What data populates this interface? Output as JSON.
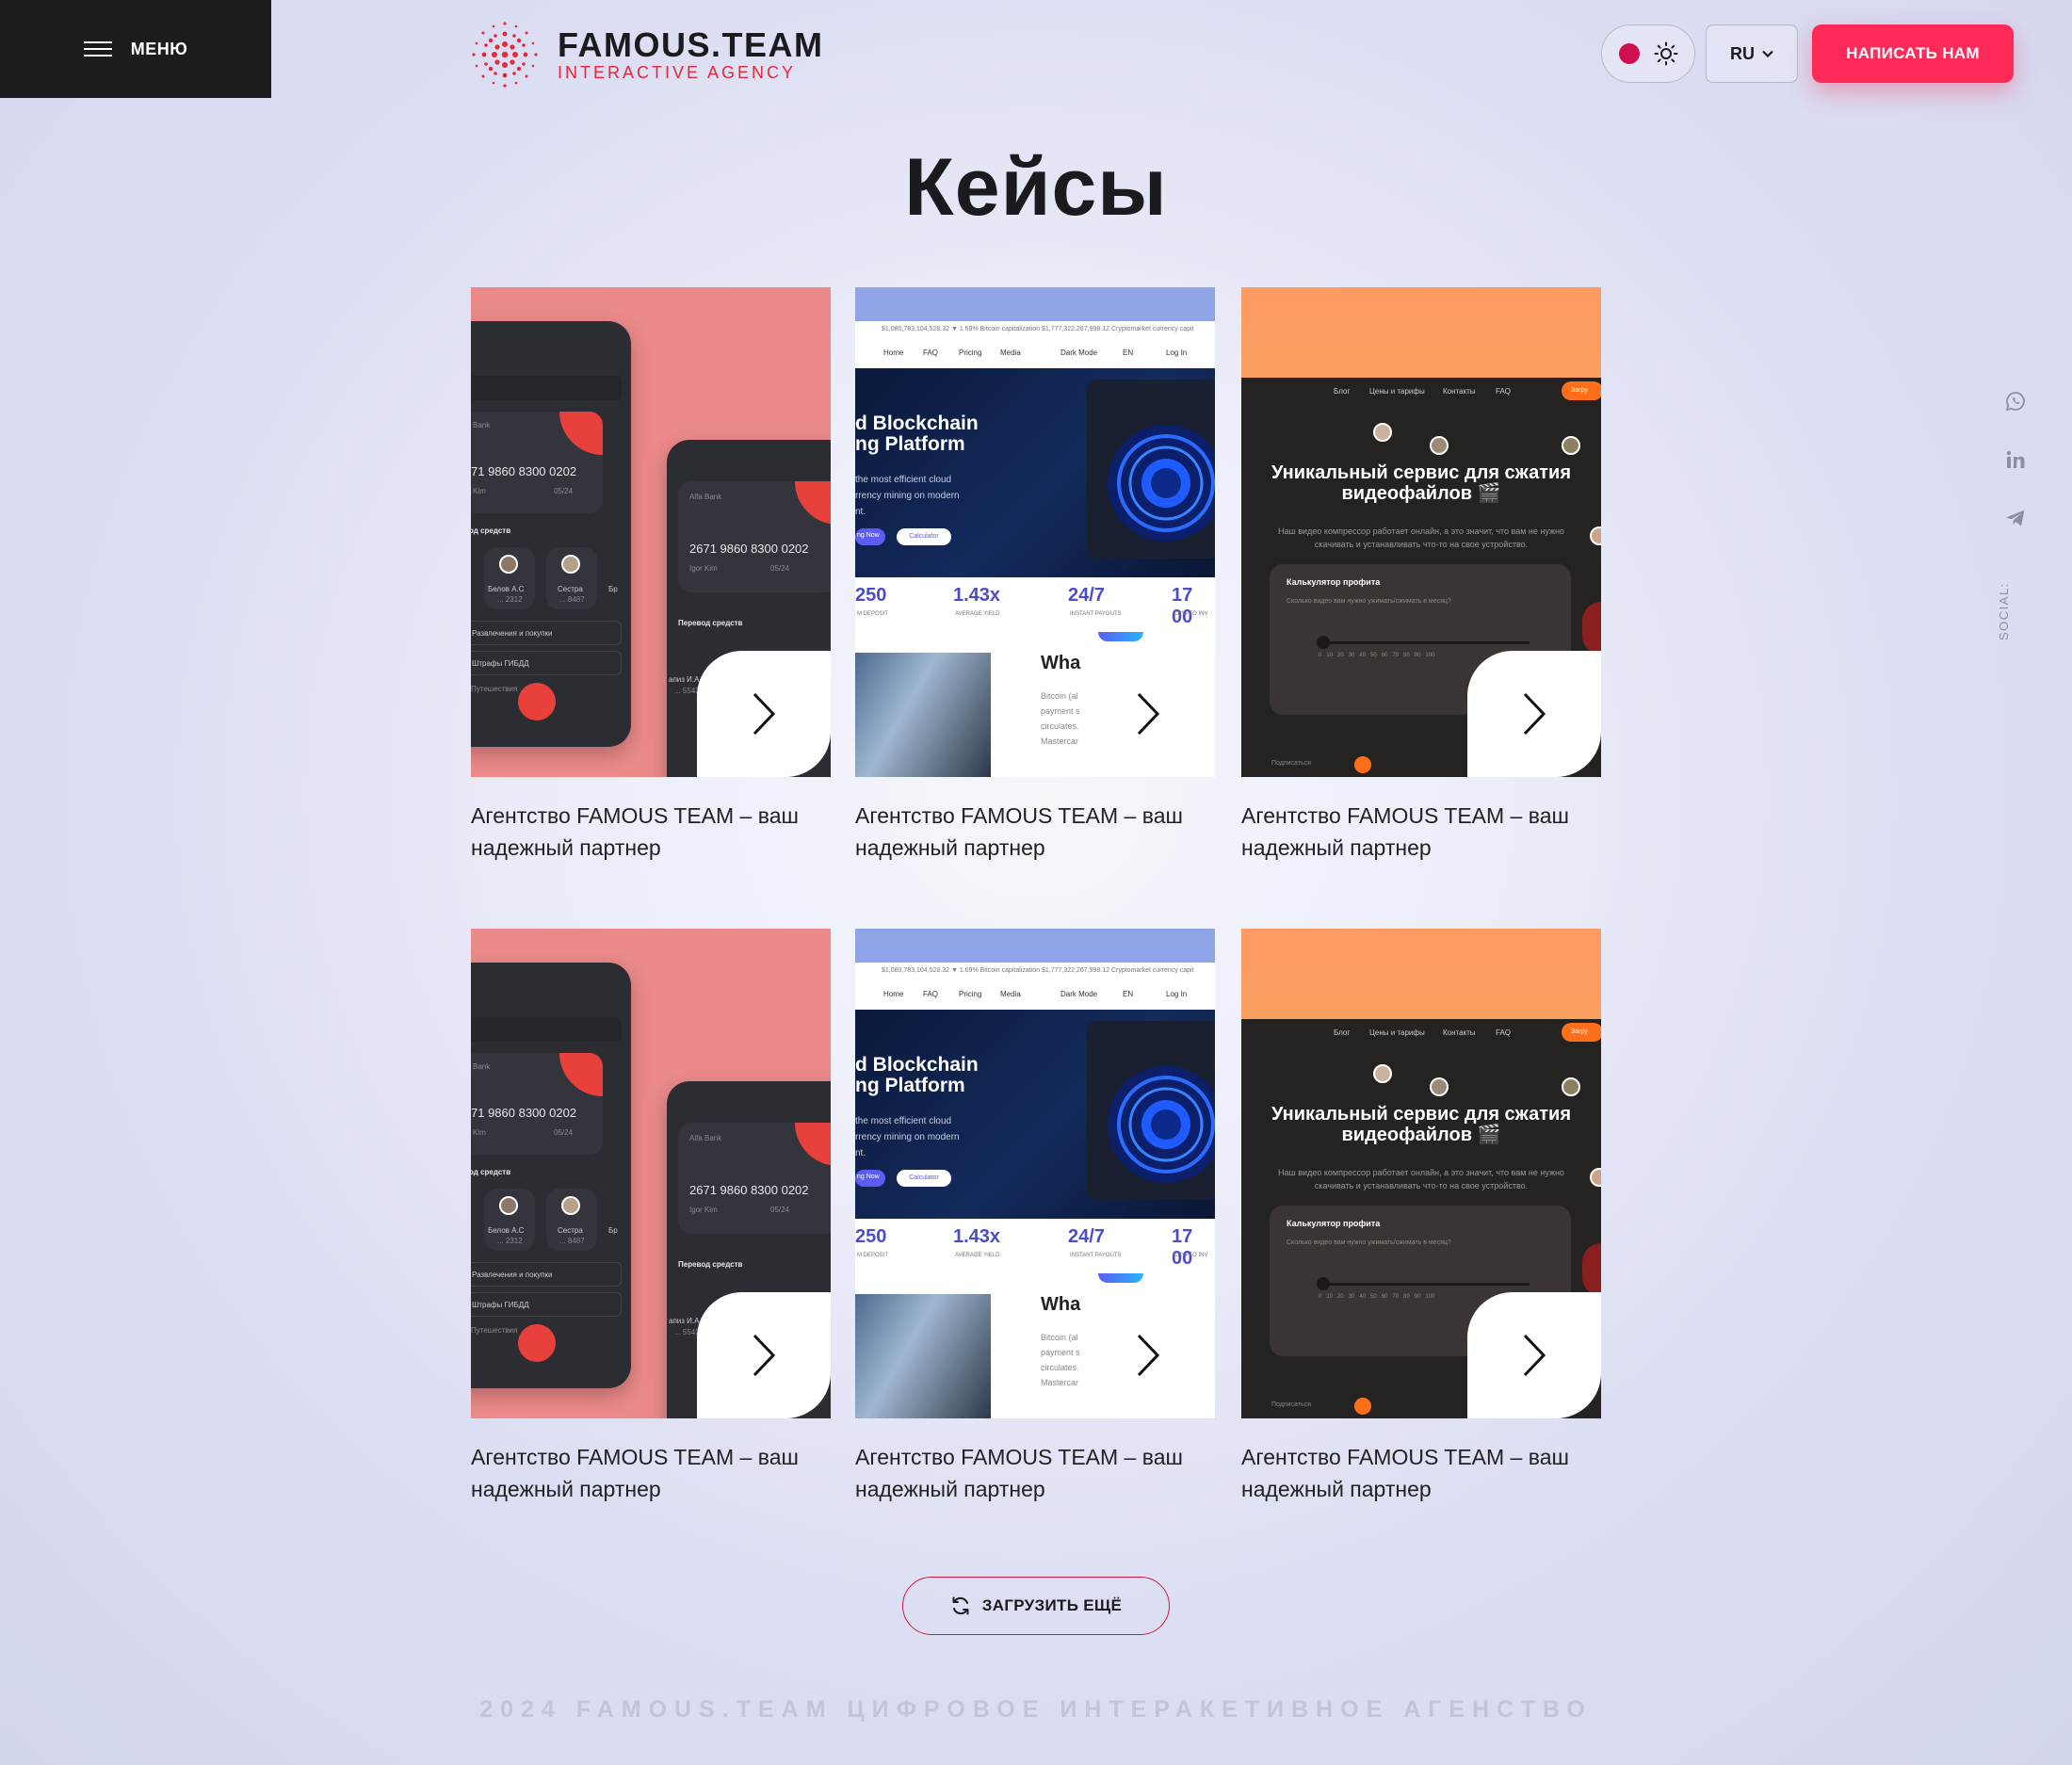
{
  "header": {
    "menu_label": "МЕНЮ",
    "logo_title": "FAMOUS.TEAM",
    "logo_subtitle": "INTERACTIVE AGENCY",
    "language": "RU",
    "cta_label": "НАПИСАТЬ НАМ",
    "theme_dot_color": "#d10f4f",
    "icons": [
      "hamburger-icon",
      "sun-icon",
      "chevron-down-icon"
    ]
  },
  "main": {
    "title": "Кейсы",
    "cards": [
      {
        "caption": "Агентство FAMOUS TEAM – ваш надежный партнер",
        "visual": "bank-app"
      },
      {
        "caption": "Агентство FAMOUS TEAM – ваш надежный партнер",
        "visual": "blockchain"
      },
      {
        "caption": "Агентство FAMOUS TEAM – ваш надежный партнер",
        "visual": "video-compressor"
      },
      {
        "caption": "Агентство FAMOUS TEAM – ваш надежный партнер",
        "visual": "bank-app"
      },
      {
        "caption": "Агентство FAMOUS TEAM – ваш надежный партнер",
        "visual": "blockchain"
      },
      {
        "caption": "Агентство FAMOUS TEAM – ваш надежный партнер",
        "visual": "video-compressor"
      }
    ],
    "load_more_label": "ЗАГРУЗИТЬ ЕЩЁ"
  },
  "mockups": {
    "bank": {
      "card_label": "Bank",
      "card_label_2": "Alfa Bank",
      "number": "71   9860   8300   0202",
      "number_2": "2671   9860   8300   0202",
      "holder": "Kim",
      "holder_2": "Igor Kim",
      "expiry": "05/24",
      "transfer_title": "од средств",
      "transfer_title_2": "Перевод средств",
      "contact_1": "Белов А.С",
      "contact_1_sub": "... 2312",
      "contact_2": "Сестра",
      "contact_2_sub": "... 8487",
      "contact_3": "Бр",
      "row_1": "Развлечения и покупки",
      "row_2": "Штрафы ГИБДД",
      "row_3": "Путешествия",
      "contact_4": "апиз И.А",
      "contact_4_sub": "... 5543"
    },
    "chain": {
      "ticker": "$1,080,783,104,528.32   ▼ 1.69%   Bitcoin capitalization   $1,777,322,267,998.12   Cryptomarket currency capit",
      "nav": [
        "Home",
        "FAQ",
        "Pricing",
        "Media",
        "Dark Mode",
        "EN",
        "Log In"
      ],
      "heading": "d Blockchain\nng Platform",
      "paragraph": "the most efficient cloud\nrrency mining on modern\nnt.",
      "btn_primary": "ng Now",
      "btn_secondary": "Calculator",
      "stats": [
        {
          "value": "250",
          "label": "M DEPOSIT"
        },
        {
          "value": "1.43x",
          "label": "AVERAGE YIELD"
        },
        {
          "value": "24/7",
          "label": "INSTANT PAYOUTS"
        },
        {
          "value": "17 00",
          "label": "CRYPTO INV"
        }
      ],
      "what_heading": "Wha",
      "what_text": "Bitcoin (al\npayment s\ncirculates.\nMastercar"
    },
    "video": {
      "nav": [
        "Блог",
        "Цены и тарифы",
        "Контакты",
        "FAQ"
      ],
      "nav_button": "Загру",
      "heading": "Уникальный сервис для сжатия видеофайлов 🎬",
      "paragraph": "Наш видео компрессор работает онлайн, а это значит, что вам не нужно скачивать и устанавливать что-то на свое устройство.",
      "calc_title": "Калькулятор профита",
      "calc_sub": "Сколько видео вам нужно ужимать/сжимать в месяц?",
      "scale": "0   10   20   30   40   50   60   70   80   90   100",
      "footer": "Подписаться"
    }
  },
  "social": {
    "label": "SOCIAL:",
    "icons": [
      "whatsapp-icon",
      "linkedin-icon",
      "telegram-icon"
    ]
  },
  "footer": {
    "text": "2024 FAMOUS.TEAM ЦИФРОВОЕ ИНТЕРАКЕТИВНОЕ АГЕНСТВО"
  },
  "colors": {
    "accent": "#ff2a57",
    "brand_red": "#e5283a",
    "menu_bg": "#1c1c1e",
    "text": "#1b1b1f",
    "footer_text": "#c2c4dc"
  }
}
